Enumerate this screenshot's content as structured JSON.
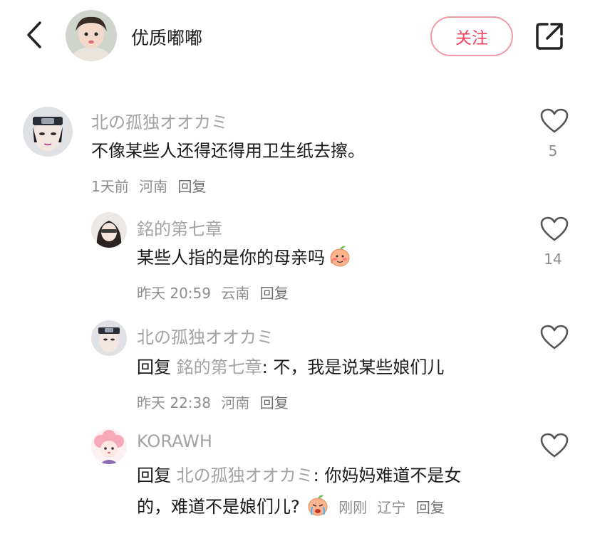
{
  "header": {
    "author_name": "优质嘟嘟",
    "follow_label": "关注",
    "back_icon": "chevron-left-icon",
    "share_icon": "share-out-icon"
  },
  "colors": {
    "accent": "#f0415d",
    "secondary_text": "#a3a3a3",
    "meta_text": "#8d8d8d"
  },
  "comments": [
    {
      "author": "北の孤独オオカミ",
      "text": "不像某些人还得还得用卫生纸去擦。",
      "time": "1天前",
      "location": "河南",
      "reply_label": "回复",
      "likes": "5"
    },
    {
      "author": "銘的第七章",
      "text": "某些人指的是你的母亲吗",
      "time": "昨天 20:59",
      "location": "云南",
      "reply_label": "回复",
      "likes": "14",
      "emoji": "blushing-peach-emoji"
    },
    {
      "author": "北の孤独オオカミ",
      "reply_prefix": "回复",
      "reply_to": "銘的第七章",
      "text": ": 不，我是说某些娘们儿",
      "time": "昨天 22:38",
      "location": "河南",
      "reply_label": "回复"
    },
    {
      "author": "KORAWH",
      "reply_prefix": "回复",
      "reply_to": "北の孤独オオカミ",
      "text_line1": ": 你妈妈难道不是女",
      "text_line2": "的，难道不是娘们儿?",
      "time": "刚刚",
      "location": "辽宁",
      "reply_label": "回复",
      "emoji": "crying-peach-emoji"
    }
  ]
}
